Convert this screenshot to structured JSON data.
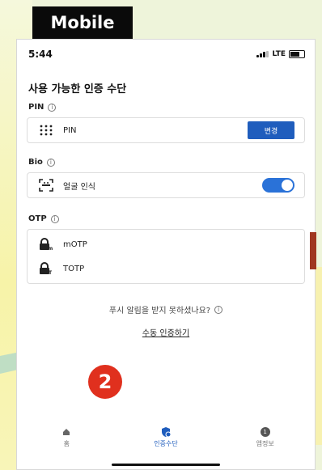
{
  "overlay": {
    "mobile_tag": "Mobile",
    "step_number": "2"
  },
  "status_bar": {
    "time": "5:44",
    "network": "LTE"
  },
  "page": {
    "title": "사용 가능한 인증 수단"
  },
  "sections": {
    "pin": {
      "label": "PIN",
      "info": "i",
      "item_label": "PIN",
      "change_label": "변경",
      "icon": "keypad-icon"
    },
    "bio": {
      "label": "Bio",
      "info": "i",
      "item_label": "얼굴 인식",
      "icon": "face-scan-icon",
      "enabled": true
    },
    "otp": {
      "label": "OTP",
      "info": "i",
      "items": [
        {
          "label": "mOTP",
          "icon": "lock-m-icon"
        },
        {
          "label": "TOTP",
          "icon": "lock-t-icon"
        }
      ]
    }
  },
  "footer": {
    "push_question": "푸시 알림을 받지 못하셨나요?",
    "manual_auth": "수동 인증하기"
  },
  "tabbar": {
    "tabs": [
      {
        "label": "홈",
        "icon": "home-icon",
        "active": false
      },
      {
        "label": "인증수단",
        "icon": "shield-key-icon",
        "active": true
      },
      {
        "label": "앱정보",
        "icon": "info-badge-icon",
        "active": false,
        "badge": "1"
      }
    ]
  },
  "colors": {
    "accent": "#1f5dbd",
    "step_badge": "#e0301e",
    "toggle_on": "#2a72d8"
  }
}
